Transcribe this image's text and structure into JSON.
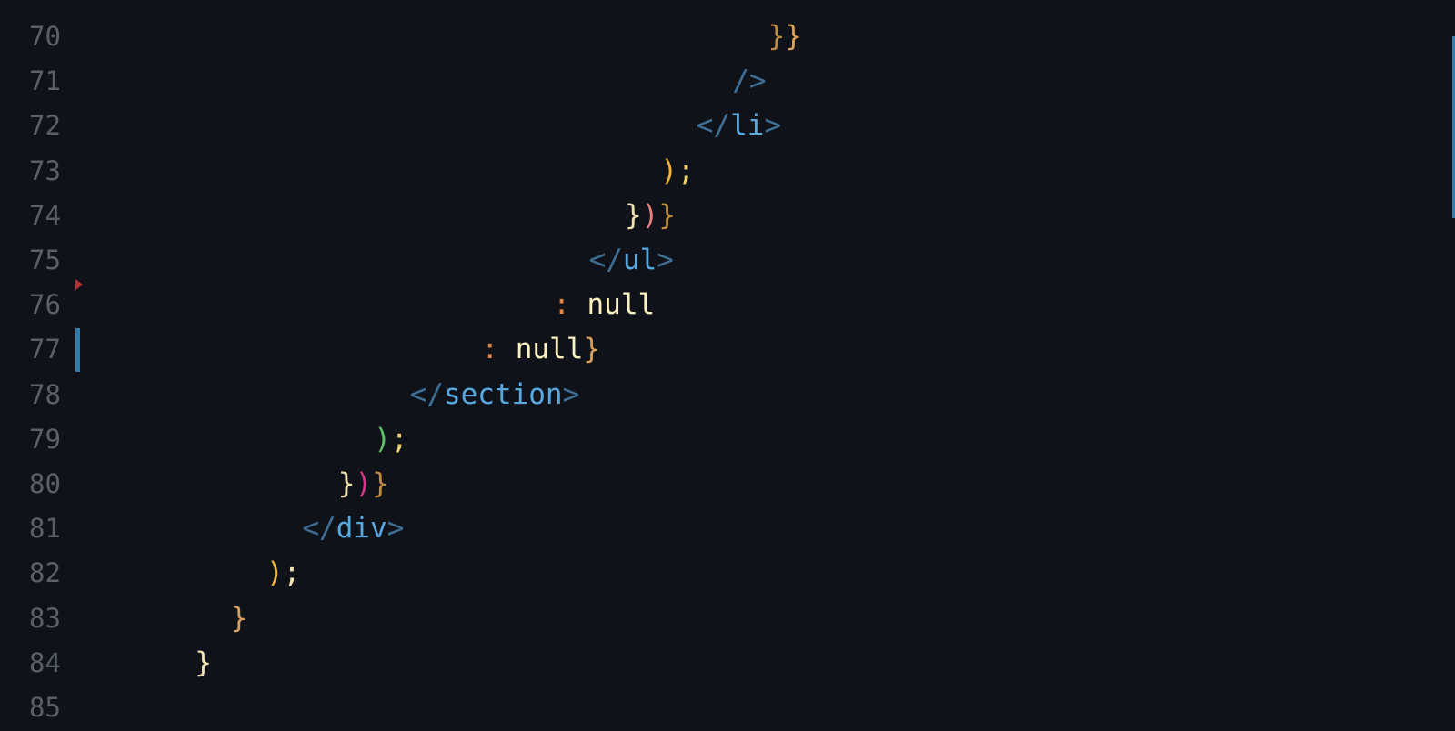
{
  "editor": {
    "lines": [
      {
        "number": "70",
        "indent": 19,
        "tokens": [
          {
            "text": "}",
            "color": "#c08a3e"
          },
          {
            "text": "}",
            "color": "#d9a05b"
          }
        ]
      },
      {
        "number": "71",
        "indent": 18,
        "tokens": [
          {
            "text": "/>",
            "color": "#3d6f97"
          }
        ]
      },
      {
        "number": "72",
        "indent": 17,
        "tokens": [
          {
            "text": "</",
            "color": "#3d6f97"
          },
          {
            "text": "li",
            "color": "#5aa8e0"
          },
          {
            "text": ">",
            "color": "#3d6f97"
          }
        ]
      },
      {
        "number": "73",
        "indent": 16,
        "tokens": [
          {
            "text": ")",
            "color": "#f2b43c"
          },
          {
            "text": ";",
            "color": "#f0d36a"
          }
        ]
      },
      {
        "number": "74",
        "indent": 15,
        "tokens": [
          {
            "text": "}",
            "color": "#f3e2b1"
          },
          {
            "text": ")",
            "color": "#e8807a"
          },
          {
            "text": "}",
            "color": "#c08a3e"
          }
        ]
      },
      {
        "number": "75",
        "indent": 14,
        "tokens": [
          {
            "text": "</",
            "color": "#3d6f97"
          },
          {
            "text": "ul",
            "color": "#5aa8e0"
          },
          {
            "text": ">",
            "color": "#3d6f97"
          }
        ]
      },
      {
        "number": "76",
        "indent": 13,
        "tokens": [
          {
            "text": ": ",
            "color": "#e0874a"
          },
          {
            "text": "null",
            "color": "#fdf2c0"
          }
        ]
      },
      {
        "number": "77",
        "indent": 11,
        "tokens": [
          {
            "text": ": ",
            "color": "#e0874a"
          },
          {
            "text": "null",
            "color": "#fdf2c0"
          },
          {
            "text": "}",
            "color": "#d9a05b"
          }
        ]
      },
      {
        "number": "78",
        "indent": 9,
        "tokens": [
          {
            "text": "</",
            "color": "#3d6f97"
          },
          {
            "text": "section",
            "color": "#5aa8e0"
          },
          {
            "text": ">",
            "color": "#3d6f97"
          }
        ]
      },
      {
        "number": "79",
        "indent": 8,
        "tokens": [
          {
            "text": ")",
            "color": "#5fc26b"
          },
          {
            "text": ";",
            "color": "#f0d36a"
          }
        ]
      },
      {
        "number": "80",
        "indent": 7,
        "tokens": [
          {
            "text": "}",
            "color": "#f3e2b1"
          },
          {
            "text": ")",
            "color": "#d9338a"
          },
          {
            "text": "}",
            "color": "#c08a3e"
          }
        ]
      },
      {
        "number": "81",
        "indent": 6,
        "tokens": [
          {
            "text": "</",
            "color": "#3d6f97"
          },
          {
            "text": "div",
            "color": "#5aa8e0"
          },
          {
            "text": ">",
            "color": "#3d6f97"
          }
        ]
      },
      {
        "number": "82",
        "indent": 5,
        "tokens": [
          {
            "text": ")",
            "color": "#f2b43c"
          },
          {
            "text": ";",
            "color": "#f3e2b1"
          }
        ]
      },
      {
        "number": "83",
        "indent": 4,
        "tokens": [
          {
            "text": "}",
            "color": "#d9a05b"
          }
        ]
      },
      {
        "number": "84",
        "indent": 3,
        "tokens": [
          {
            "text": "}",
            "color": "#f3e2b1"
          }
        ]
      },
      {
        "number": "85",
        "indent": 0,
        "tokens": []
      }
    ]
  },
  "colors": {
    "background": "#0f1319",
    "line_number": "#5a6068",
    "git_modified": "#2f7dab",
    "fold_marker": "#b8312f"
  }
}
